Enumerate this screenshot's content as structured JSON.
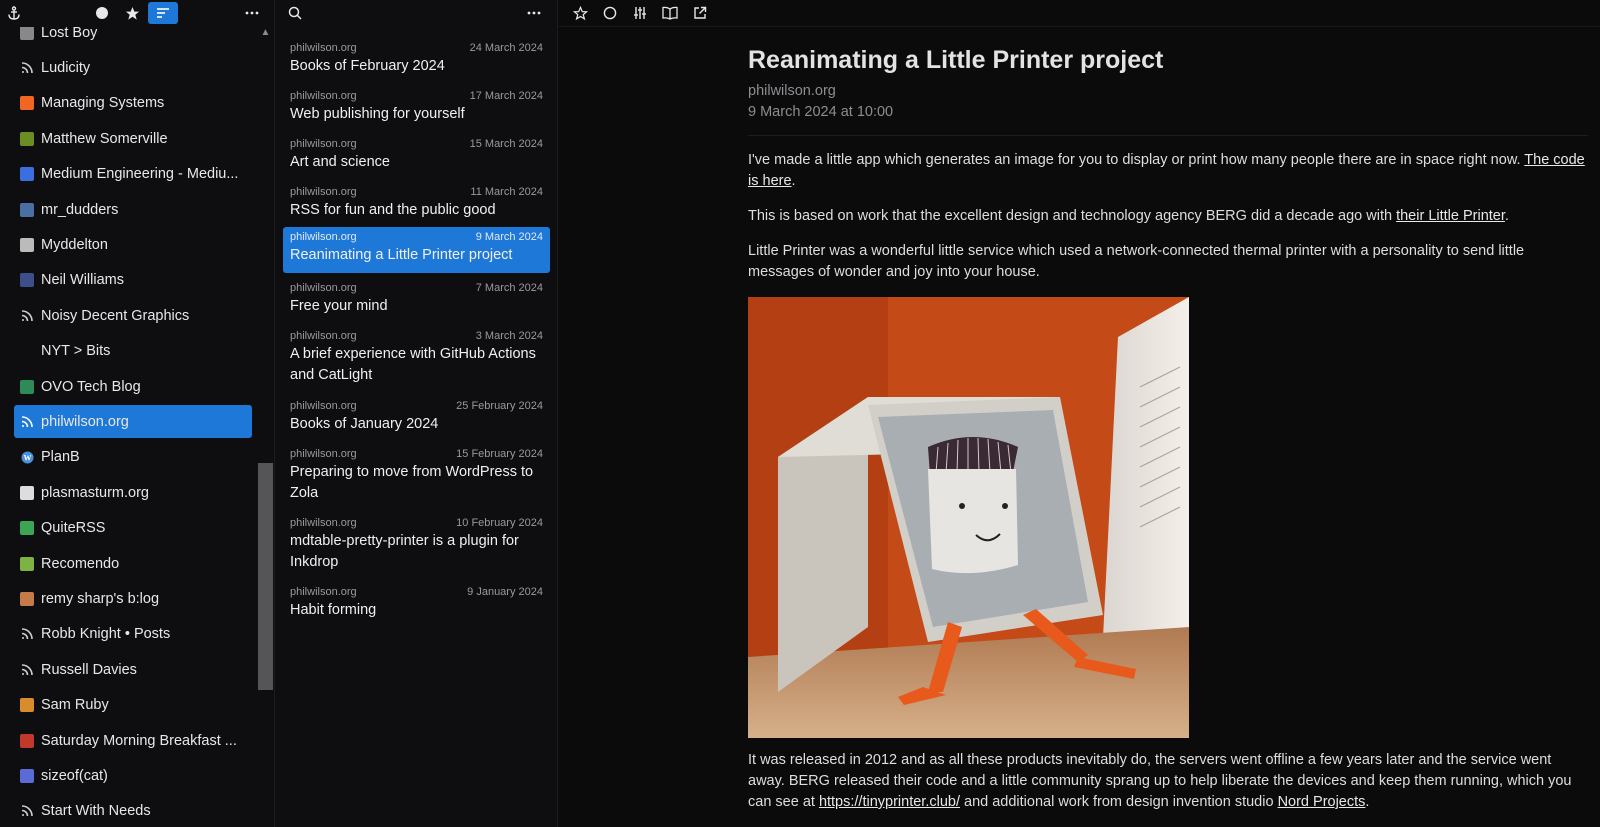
{
  "sidebar": {
    "items": [
      {
        "label": "Lost Boy",
        "icon": "site-favicon",
        "color": "#888888",
        "selected": false
      },
      {
        "label": "Ludicity",
        "icon": "rss-icon",
        "color": "#cfcfcf",
        "selected": false
      },
      {
        "label": "Managing Systems",
        "icon": "site-favicon",
        "color": "#f26522",
        "selected": false
      },
      {
        "label": "Matthew Somerville",
        "icon": "site-favicon",
        "color": "#6b8e23",
        "selected": false
      },
      {
        "label": "Medium Engineering - Mediu...",
        "icon": "site-favicon",
        "color": "#3b6fe0",
        "selected": false
      },
      {
        "label": "mr_dudders",
        "icon": "site-favicon",
        "color": "#4a6fa5",
        "selected": false
      },
      {
        "label": "Myddelton",
        "icon": "site-favicon",
        "color": "#bbbbbb",
        "selected": false
      },
      {
        "label": "Neil Williams",
        "icon": "site-favicon",
        "color": "#3d4f8a",
        "selected": false
      },
      {
        "label": "Noisy Decent Graphics",
        "icon": "rss-icon",
        "color": "#cfcfcf",
        "selected": false
      },
      {
        "label": "NYT > Bits",
        "icon": "none",
        "color": "#0e0e10",
        "selected": false
      },
      {
        "label": "OVO Tech Blog",
        "icon": "site-favicon",
        "color": "#2e8b57",
        "selected": false
      },
      {
        "label": "philwilson.org",
        "icon": "rss-icon",
        "color": "#ffffff",
        "selected": true
      },
      {
        "label": "PlanB",
        "icon": "wordpress-icon",
        "color": "#4a90d9",
        "selected": false
      },
      {
        "label": "plasmasturm.org",
        "icon": "site-favicon",
        "color": "#dddddd",
        "selected": false
      },
      {
        "label": "QuiteRSS",
        "icon": "site-favicon",
        "color": "#3aa655",
        "selected": false
      },
      {
        "label": "Recomendo",
        "icon": "site-favicon",
        "color": "#7cb342",
        "selected": false
      },
      {
        "label": "remy sharp's b:log",
        "icon": "site-favicon",
        "color": "#c67a4a",
        "selected": false
      },
      {
        "label": "Robb Knight • Posts",
        "icon": "rss-icon",
        "color": "#cfcfcf",
        "selected": false
      },
      {
        "label": "Russell Davies",
        "icon": "rss-icon",
        "color": "#cfcfcf",
        "selected": false
      },
      {
        "label": "Sam Ruby",
        "icon": "site-favicon",
        "color": "#d98c2b",
        "selected": false
      },
      {
        "label": "Saturday Morning Breakfast ...",
        "icon": "site-favicon",
        "color": "#c0392b",
        "selected": false
      },
      {
        "label": "sizeof(cat)",
        "icon": "site-favicon",
        "color": "#5b6bd6",
        "selected": false
      },
      {
        "label": "Start With Needs",
        "icon": "rss-icon",
        "color": "#cfcfcf",
        "selected": false
      }
    ]
  },
  "list": {
    "articles": [
      {
        "source": "philwilson.org",
        "date": "24 March 2024",
        "title": "Books of February 2024"
      },
      {
        "source": "philwilson.org",
        "date": "17 March 2024",
        "title": "Web publishing for yourself"
      },
      {
        "source": "philwilson.org",
        "date": "15 March 2024",
        "title": "Art and science"
      },
      {
        "source": "philwilson.org",
        "date": "11 March 2024",
        "title": "RSS for fun and the public good"
      },
      {
        "source": "philwilson.org",
        "date": "9 March 2024",
        "title": "Reanimating a Little Printer project"
      },
      {
        "source": "philwilson.org",
        "date": "7 March 2024",
        "title": "Free your mind"
      },
      {
        "source": "philwilson.org",
        "date": "3 March 2024",
        "title": "A brief experience with GitHub Actions and CatLight"
      },
      {
        "source": "philwilson.org",
        "date": "25 February 2024",
        "title": "Books of January 2024"
      },
      {
        "source": "philwilson.org",
        "date": "15 February 2024",
        "title": "Preparing to move from WordPress to Zola"
      },
      {
        "source": "philwilson.org",
        "date": "10 February 2024",
        "title": "mdtable-pretty-printer is a plugin for Inkdrop"
      },
      {
        "source": "philwilson.org",
        "date": "9 January 2024",
        "title": "Habit forming"
      }
    ]
  },
  "article": {
    "title": "Reanimating a Little Printer project",
    "source": "philwilson.org",
    "date": "9 March 2024 at 10:00",
    "p1_text": "I've made a little app which generates an image for you to display or print how many people there are in space right now. ",
    "p1_link": "The code is here",
    "p1_end": ".",
    "p2_text": "This is based on work that the excellent design and technology agency BERG did a decade ago with ",
    "p2_link": "their Little Printer",
    "p2_end": ".",
    "p3_text": "Little Printer was a wonderful little service which used a network-connected thermal printer with a personality to send little messages of wonder and joy into your house.",
    "p4_text": "It was released in 2012 and as all these products inevitably do, the servers went offline a few years later and the service went away. BERG released their code and a little community sprang up to help liberate the devices and keep them running, which you can see at ",
    "p4_link1": "https://tinyprinter.club/",
    "p4_mid": " and additional work from design invention studio ",
    "p4_link2": "Nord Projects",
    "p4_end": "."
  },
  "colors": {
    "accent": "#1e78d8",
    "background": "#0b0b0c"
  }
}
